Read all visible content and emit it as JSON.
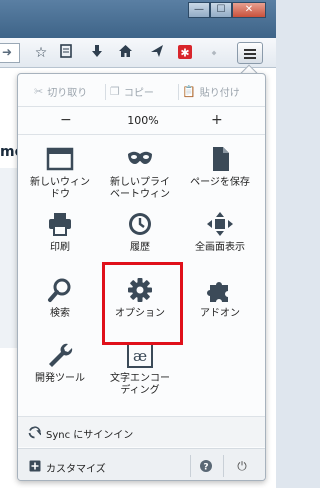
{
  "window": {
    "minimize": "—",
    "maximize": "☐",
    "close": "✕"
  },
  "toolbar": {
    "icons": [
      "star-icon",
      "reading-list-icon",
      "download-icon",
      "home-icon",
      "share-icon",
      "addon-red-icon"
    ]
  },
  "page": {
    "partial_text": "mo"
  },
  "menu": {
    "edit": {
      "cut": "切り取り",
      "copy": "コピー",
      "paste": "貼り付け"
    },
    "zoom": {
      "minus": "−",
      "value": "100%",
      "plus": "+"
    },
    "items": [
      {
        "label_line1": "新しいウィン",
        "label_line2": "ドウ",
        "icon": "new-window-icon"
      },
      {
        "label_line1": "新しいプライ",
        "label_line2": "ベートウィン",
        "icon": "private-window-icon"
      },
      {
        "label_line1": "ページを保存",
        "label_line2": "",
        "icon": "save-page-icon"
      },
      {
        "label_line1": "印刷",
        "label_line2": "",
        "icon": "print-icon"
      },
      {
        "label_line1": "履歴",
        "label_line2": "",
        "icon": "history-icon"
      },
      {
        "label_line1": "全画面表示",
        "label_line2": "",
        "icon": "fullscreen-icon"
      },
      {
        "label_line1": "検索",
        "label_line2": "",
        "icon": "search-icon"
      },
      {
        "label_line1": "オプション",
        "label_line2": "",
        "icon": "options-gear-icon"
      },
      {
        "label_line1": "アドオン",
        "label_line2": "",
        "icon": "addons-puzzle-icon"
      },
      {
        "label_line1": "開発ツール",
        "label_line2": "",
        "icon": "developer-wrench-icon"
      },
      {
        "label_line1": "文字エンコー",
        "label_line2": "ディング",
        "icon": "text-encoding-icon"
      }
    ],
    "sync_label": "Sync にサインイン",
    "customize_label": "カスタマイズ",
    "help": "?",
    "quit": "⏻"
  },
  "colors": {
    "highlight": "#e0101a",
    "icon": "#3b4a58"
  }
}
